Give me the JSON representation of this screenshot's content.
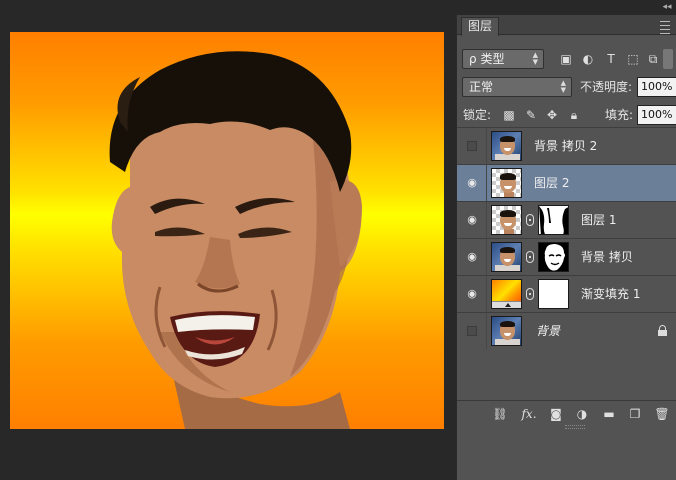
{
  "canvas": {
    "image_alt": "laughing man portrait on orange-yellow gradient"
  },
  "layers_panel": {
    "tab_label": "图层",
    "filter": {
      "type_label": "类型",
      "search_glyph": "ρ",
      "icons": [
        "image-filter-icon",
        "adjustment-filter-icon",
        "type-filter-icon",
        "shape-filter-icon",
        "smart-object-filter-icon"
      ]
    },
    "blend_mode": "正常",
    "opacity_label": "不透明度:",
    "opacity_value": "100%",
    "lock_label": "锁定:",
    "fill_label": "填充:",
    "fill_value": "100%",
    "layers": [
      {
        "name": "背景 拷贝 2",
        "visible": false,
        "thumb": "photo",
        "selected": false
      },
      {
        "name": "图层 2",
        "visible": true,
        "thumb": "cutout",
        "selected": true
      },
      {
        "name": "图层 1",
        "visible": true,
        "thumb": "cutout",
        "mask": "silhouette",
        "selected": false
      },
      {
        "name": "背景 拷贝",
        "visible": true,
        "thumb": "photo",
        "mask": "head-white",
        "selected": false
      },
      {
        "name": "渐变填充 1",
        "visible": true,
        "thumb": "gradient",
        "mask": "white",
        "selected": false
      },
      {
        "name": "背景",
        "visible": false,
        "thumb": "photo",
        "locked": true,
        "selected": false
      }
    ],
    "footer_icons": [
      "link-layers-icon",
      "fx-icon",
      "add-mask-icon",
      "adjustment-layer-icon",
      "group-folder-icon",
      "new-layer-icon",
      "trash-icon"
    ],
    "fx_label": "fx."
  }
}
